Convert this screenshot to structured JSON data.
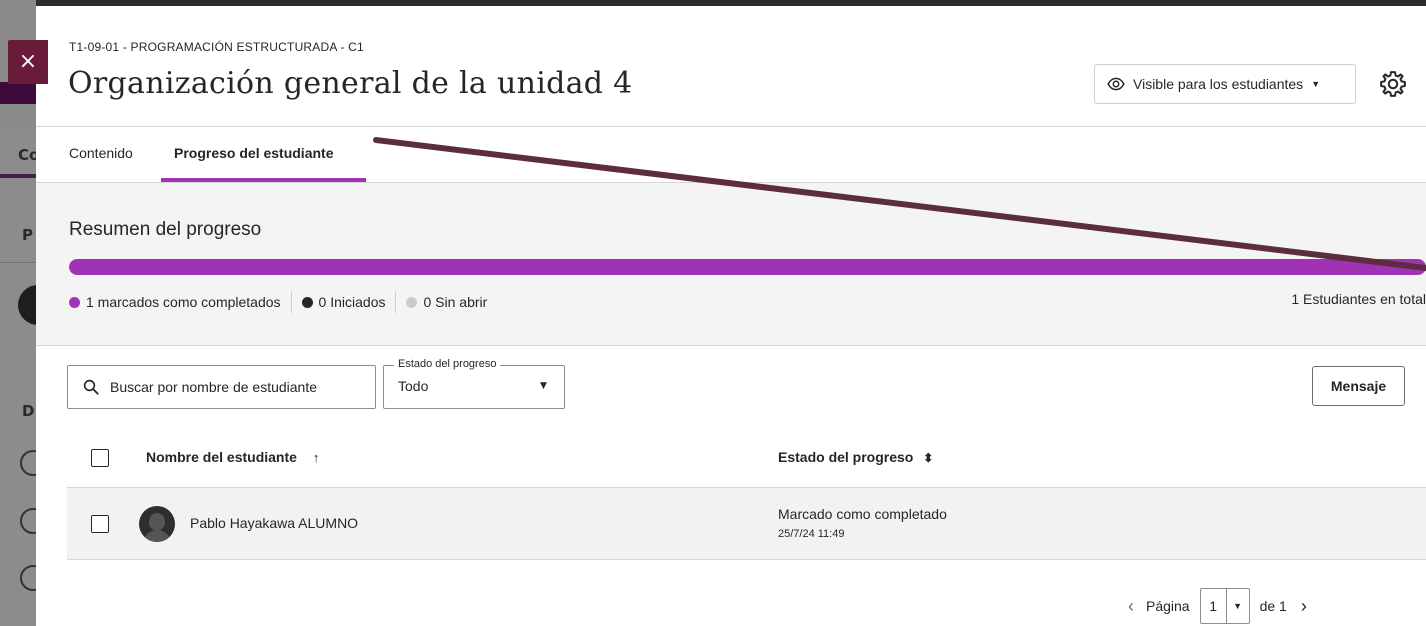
{
  "background": {
    "letters": [
      "Co",
      "P",
      "D"
    ]
  },
  "close_button": {
    "label": "×"
  },
  "header": {
    "course_id": "T1-09-01 - PROGRAMACIÓN ESTRUCTURADA - C1",
    "title": "Organización general de la unidad 4",
    "visibility_label": "Visible para los estudiantes"
  },
  "tabs": [
    {
      "label": "Contenido",
      "active": false
    },
    {
      "label": "Progreso del estudiante",
      "active": true
    }
  ],
  "summary": {
    "title": "Resumen del progreso",
    "completed_fraction": 1.0,
    "legend": {
      "completed": "1 marcados como completados",
      "started": "0 Iniciados",
      "unopened": "0 Sin abrir"
    },
    "total": "1 Estudiantes en total",
    "colors": {
      "completed": "#a033b3",
      "started": "#262626",
      "unopened": "#cccccc"
    }
  },
  "controls": {
    "search_placeholder": "Buscar por nombre de estudiante",
    "filter_label": "Estado del progreso",
    "filter_value": "Todo",
    "message_button": "Mensaje"
  },
  "table": {
    "columns": {
      "name": "Nombre del estudiante",
      "name_sort": "↑",
      "status": "Estado del progreso",
      "status_sort": "⬍"
    },
    "rows": [
      {
        "name": "Pablo Hayakawa ALUMNO",
        "status": "Marcado como completado",
        "date": "25/7/24 11:49"
      }
    ]
  },
  "pagination": {
    "page_label": "Página",
    "current_page": "1",
    "of_label": "de 1"
  },
  "icons": {
    "close": "close-icon",
    "visibility": "eye-icon",
    "settings": "gear-icon",
    "search": "search-icon",
    "prev": "chevron-left-icon",
    "next": "chevron-right-icon"
  }
}
